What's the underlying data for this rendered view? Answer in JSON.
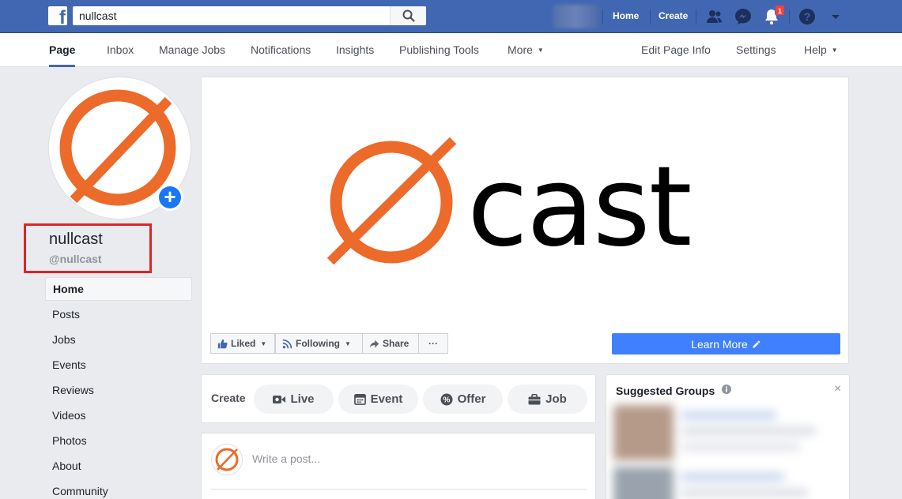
{
  "topbar": {
    "search_value": "nullcast",
    "home_label": "Home",
    "create_label": "Create",
    "notification_count": "1",
    "brand_color": "#4267b2"
  },
  "page_nav": {
    "items": [
      {
        "label": "Page",
        "active": true
      },
      {
        "label": "Inbox"
      },
      {
        "label": "Manage Jobs"
      },
      {
        "label": "Notifications"
      },
      {
        "label": "Insights"
      },
      {
        "label": "Publishing Tools"
      },
      {
        "label": "More"
      }
    ],
    "right_items": [
      {
        "label": "Edit Page Info"
      },
      {
        "label": "Settings"
      },
      {
        "label": "Help"
      }
    ]
  },
  "profile": {
    "name": "nullcast",
    "handle": "@nullcast",
    "logo_color": "#ec6a2a"
  },
  "side_nav": {
    "items": [
      "Home",
      "Posts",
      "Jobs",
      "Events",
      "Reviews",
      "Videos",
      "Photos",
      "About",
      "Community"
    ]
  },
  "cover": {
    "brand_word": "cast",
    "liked_label": "Liked",
    "following_label": "Following",
    "share_label": "Share",
    "more_label": "···",
    "learn_more_label": "Learn More"
  },
  "create": {
    "label": "Create",
    "buttons": [
      "Live",
      "Event",
      "Offer",
      "Job"
    ]
  },
  "post": {
    "placeholder": "Write a post..."
  },
  "suggested_groups": {
    "title": "Suggested Groups"
  }
}
